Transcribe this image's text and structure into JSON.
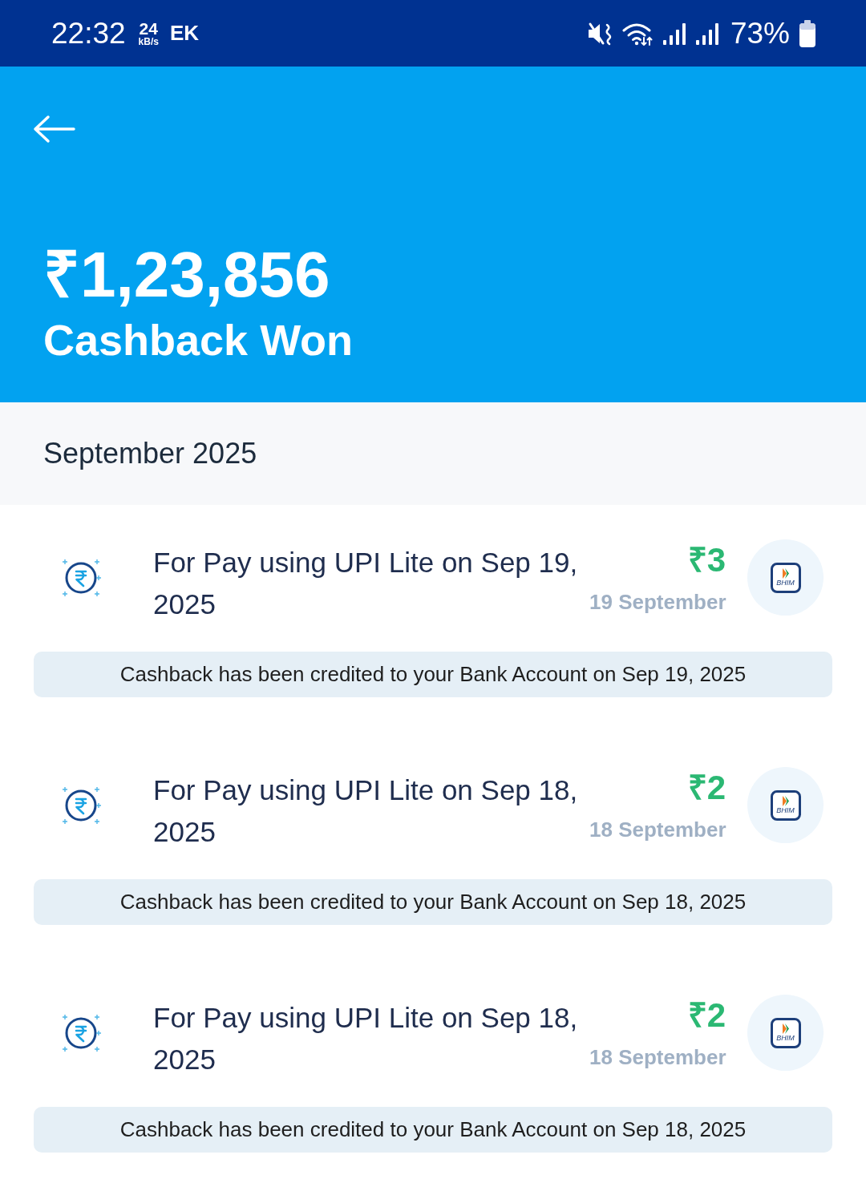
{
  "status_bar": {
    "time": "22:32",
    "data_speed": "24",
    "data_unit": "kB/s",
    "carrier": "EK",
    "battery": "73%"
  },
  "header": {
    "amount": "₹1,23,856",
    "label": "Cashback Won"
  },
  "month": "September 2025",
  "cashbacks": [
    {
      "title": "For Pay using UPI Lite on Sep 19, 2025",
      "amount": "₹3",
      "date": "19 September",
      "app_logo": "BHIM",
      "note": "Cashback has been credited to your Bank Account on Sep 19, 2025"
    },
    {
      "title": "For Pay using UPI Lite on Sep 18, 2025",
      "amount": "₹2",
      "date": "18 September",
      "app_logo": "BHIM",
      "note": "Cashback has been credited to your Bank Account on Sep 18, 2025"
    },
    {
      "title": "For Pay using UPI Lite on Sep 18, 2025",
      "amount": "₹2",
      "date": "18 September",
      "app_logo": "BHIM",
      "note": "Cashback has been credited to your Bank Account on Sep 18, 2025"
    }
  ]
}
